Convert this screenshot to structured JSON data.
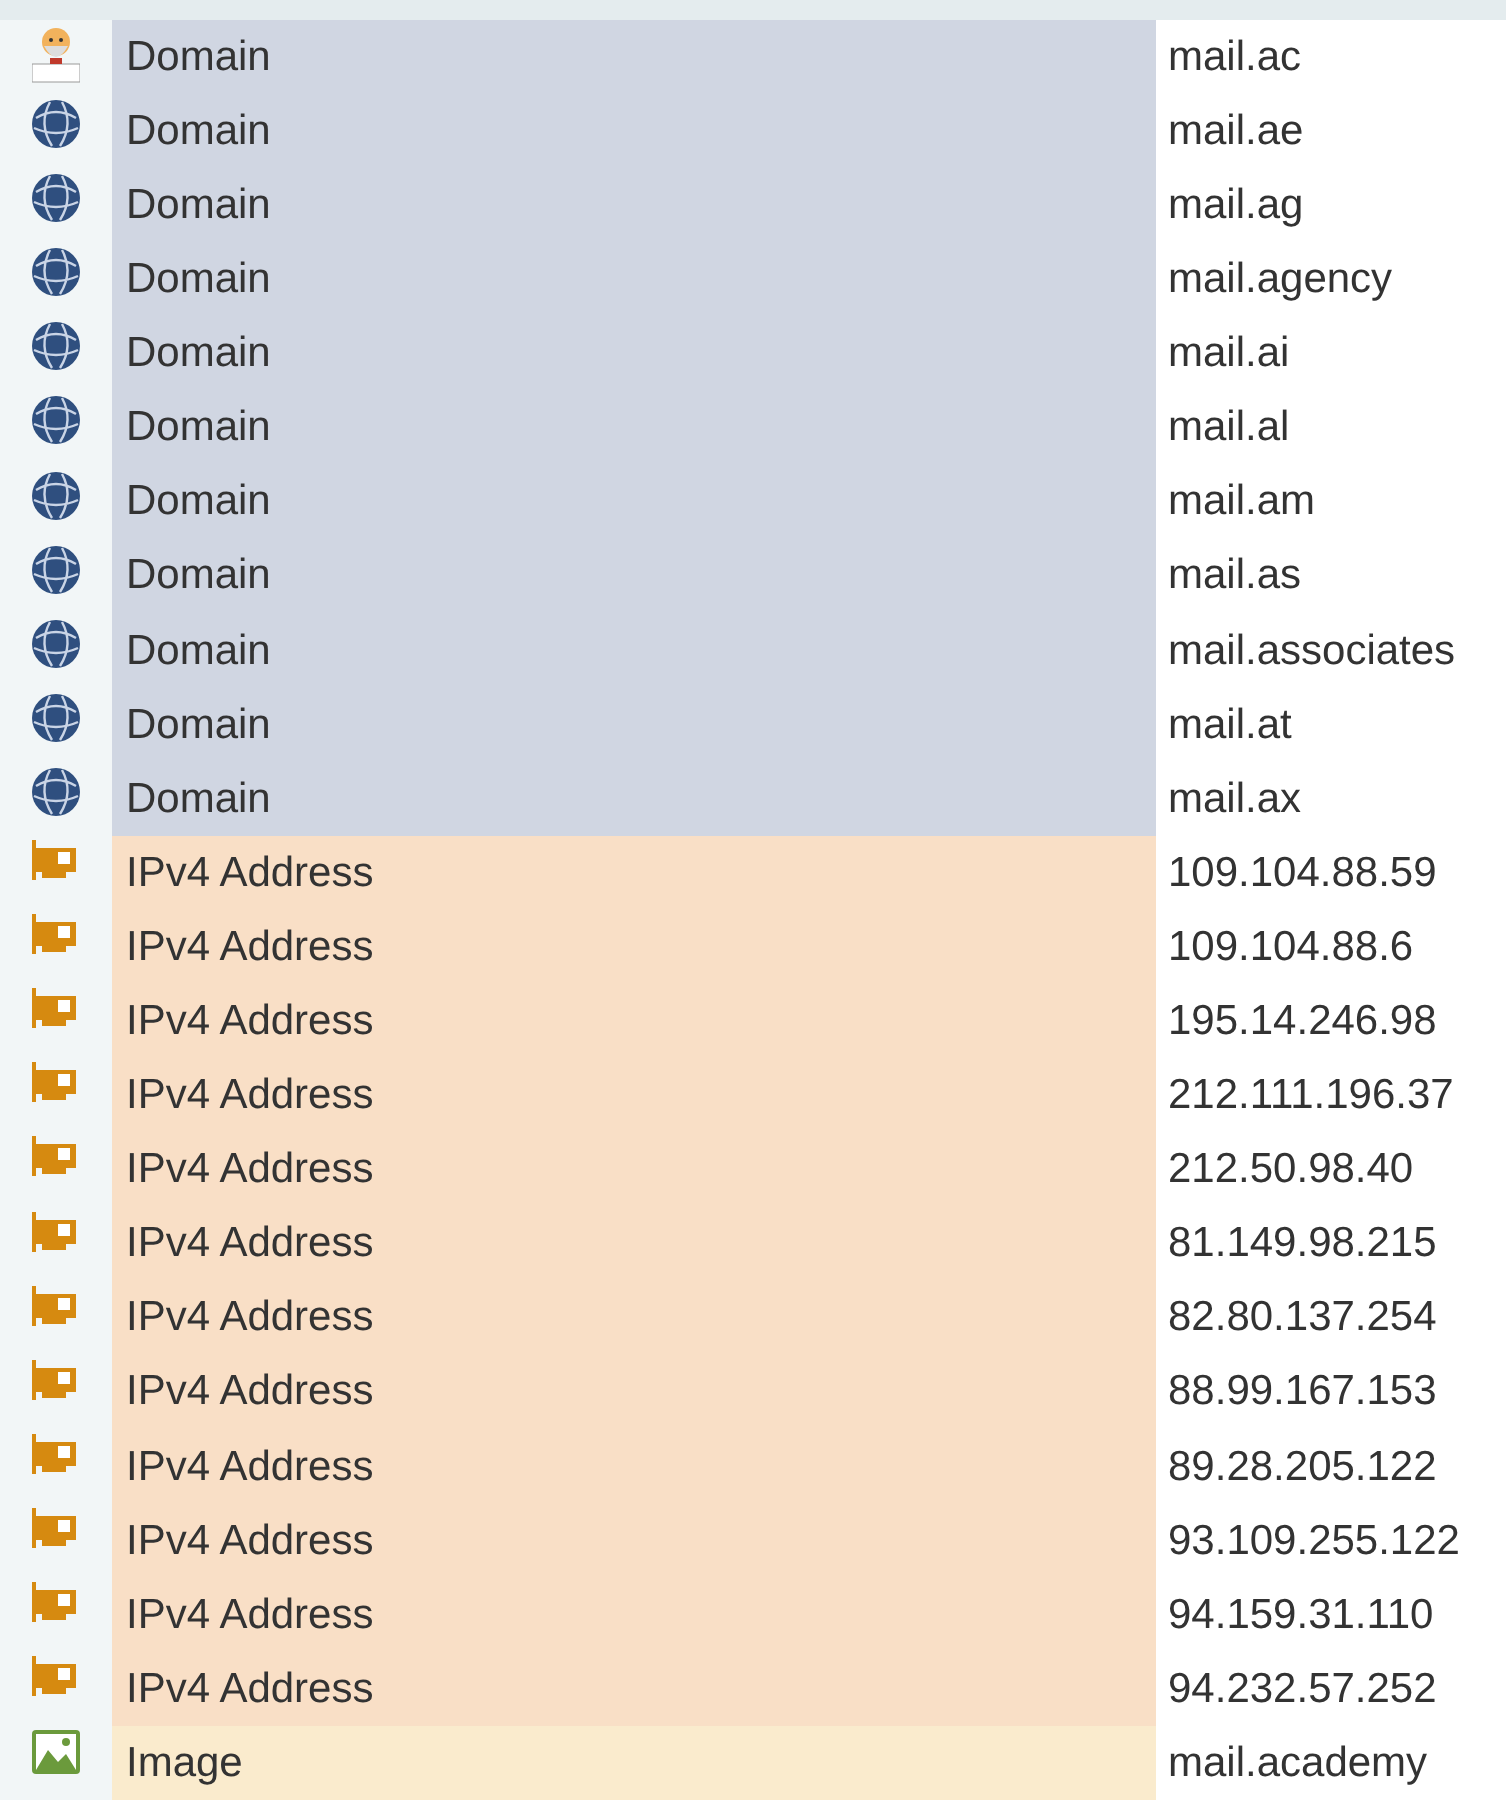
{
  "rows": [
    {
      "kind": "person",
      "type": "Domain",
      "value": "mail.ac"
    },
    {
      "kind": "domain",
      "type": "Domain",
      "value": "mail.ae"
    },
    {
      "kind": "domain",
      "type": "Domain",
      "value": "mail.ag"
    },
    {
      "kind": "domain",
      "type": "Domain",
      "value": "mail.agency"
    },
    {
      "kind": "domain",
      "type": "Domain",
      "value": "mail.ai"
    },
    {
      "kind": "domain",
      "type": "Domain",
      "value": "mail.al"
    },
    {
      "kind": "domain",
      "type": "Domain",
      "value": "mail.am"
    },
    {
      "kind": "domain",
      "type": "Domain",
      "value": "mail.as"
    },
    {
      "kind": "domain",
      "type": "Domain",
      "value": "mail.associates"
    },
    {
      "kind": "domain",
      "type": "Domain",
      "value": "mail.at"
    },
    {
      "kind": "domain",
      "type": "Domain",
      "value": "mail.ax"
    },
    {
      "kind": "ipv4",
      "type": "IPv4 Address",
      "value": "109.104.88.59"
    },
    {
      "kind": "ipv4",
      "type": "IPv4 Address",
      "value": "109.104.88.6"
    },
    {
      "kind": "ipv4",
      "type": "IPv4 Address",
      "value": "195.14.246.98"
    },
    {
      "kind": "ipv4",
      "type": "IPv4 Address",
      "value": "212.111.196.37"
    },
    {
      "kind": "ipv4",
      "type": "IPv4 Address",
      "value": "212.50.98.40"
    },
    {
      "kind": "ipv4",
      "type": "IPv4 Address",
      "value": "81.149.98.215"
    },
    {
      "kind": "ipv4",
      "type": "IPv4 Address",
      "value": "82.80.137.254"
    },
    {
      "kind": "ipv4",
      "type": "IPv4 Address",
      "value": "88.99.167.153"
    },
    {
      "kind": "ipv4",
      "type": "IPv4 Address",
      "value": "89.28.205.122"
    },
    {
      "kind": "ipv4",
      "type": "IPv4 Address",
      "value": "93.109.255.122"
    },
    {
      "kind": "ipv4",
      "type": "IPv4 Address",
      "value": "94.159.31.110"
    },
    {
      "kind": "ipv4",
      "type": "IPv4 Address",
      "value": "94.232.57.252"
    },
    {
      "kind": "image",
      "type": "Image",
      "value": "mail.academy"
    }
  ]
}
